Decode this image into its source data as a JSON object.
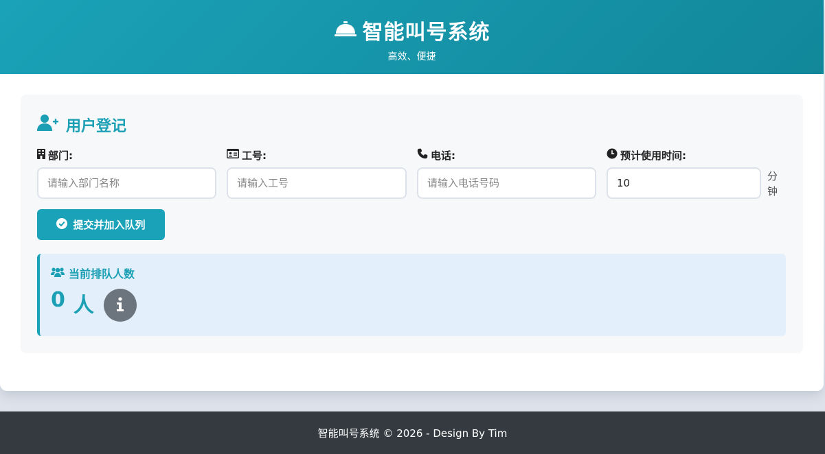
{
  "header": {
    "title": "智能叫号系统",
    "subtitle": "高效、便捷",
    "icon": "bell-icon"
  },
  "form": {
    "section_title": "用户登记",
    "department": {
      "label": "部门:",
      "placeholder": "请输入部门名称",
      "value": ""
    },
    "employee_id": {
      "label": "工号:",
      "placeholder": "请输入工号",
      "value": ""
    },
    "phone": {
      "label": "电话:",
      "placeholder": "请输入电话号码",
      "value": ""
    },
    "duration": {
      "label": "预计使用时间:",
      "value": "10",
      "unit": "分钟"
    },
    "submit_label": "提交并加入队列"
  },
  "queue": {
    "label": "当前排队人数",
    "count": "0",
    "unit": "人"
  },
  "footer": {
    "text": "智能叫号系统 © 2026 - Design By Tim"
  },
  "colors": {
    "primary": "#1aa2b8",
    "footer_bg": "#343a40",
    "queue_bg": "#e3f0fb",
    "info_button": "#6c757d"
  }
}
